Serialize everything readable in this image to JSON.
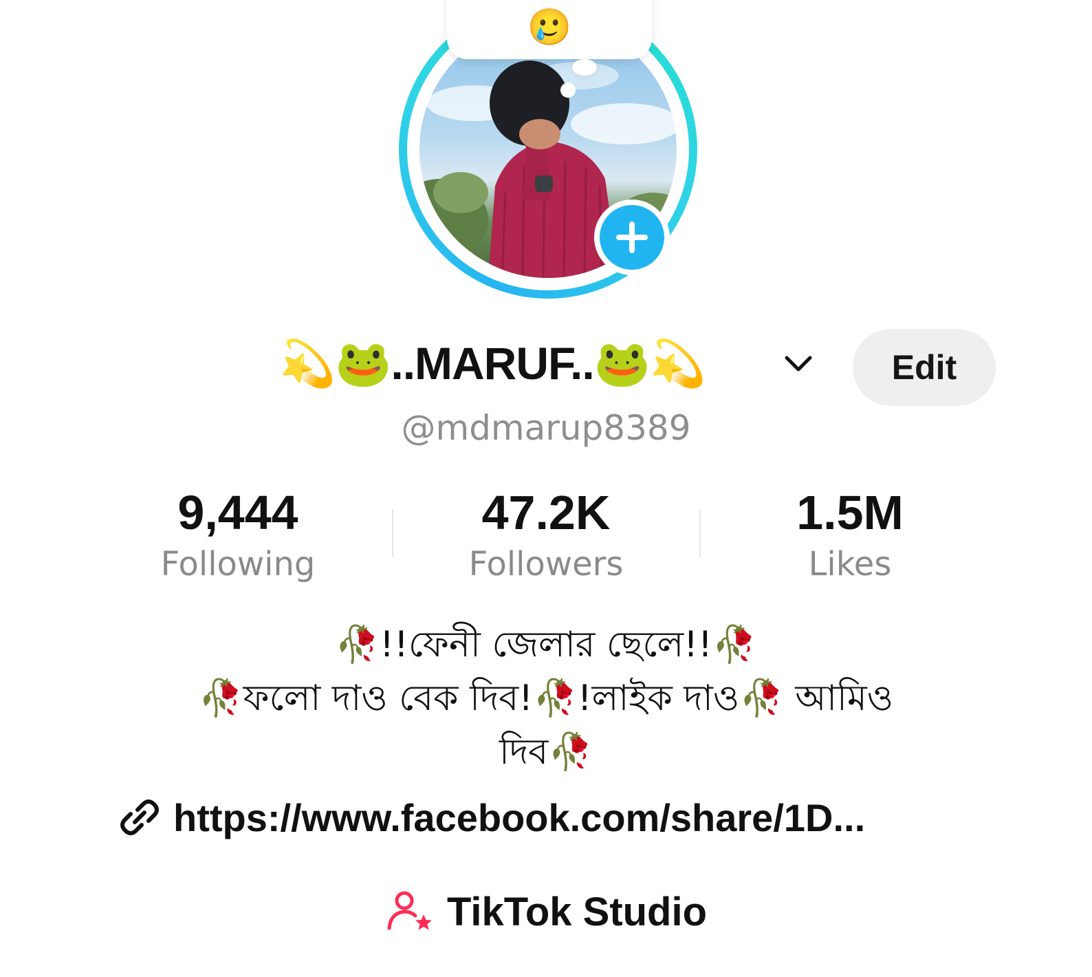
{
  "note": {
    "emoji": "🥲"
  },
  "profile": {
    "display_name": "💫🐸..MARUF..🐸💫",
    "username": "@mdmarup8389",
    "edit_label": "Edit"
  },
  "stats": [
    {
      "value": "9,444",
      "label": "Following"
    },
    {
      "value": "47.2K",
      "label": "Followers"
    },
    {
      "value": "1.5M",
      "label": "Likes"
    }
  ],
  "bio": [
    "🥀!!ফেনী জেলার ছেলে!!🥀",
    "🥀ফলো দাও বেক দিব!🥀!লাইক দাও🥀 আমিও",
    "দিব🥀"
  ],
  "link": {
    "text": "https://www.facebook.com/share/1D..."
  },
  "studio": {
    "label": "TikTok Studio"
  },
  "colors": {
    "ring": "#27b4f2",
    "add_button": "#20b5f0",
    "studio_icon": "#fe2c55",
    "secondary_text": "#8a8a8a"
  },
  "icons": {
    "add_story": "plus-icon",
    "name_dropdown": "chevron-down-icon",
    "link": "link-icon",
    "studio": "person-star-icon"
  }
}
